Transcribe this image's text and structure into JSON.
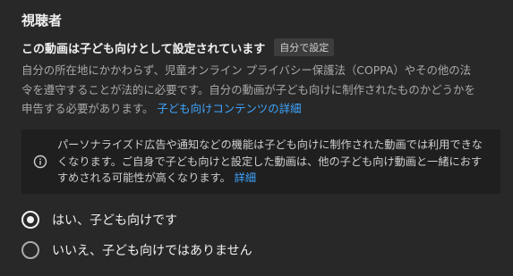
{
  "audience": {
    "title": "視聴者",
    "status_text": "この動画は子ども向けとして設定されています",
    "status_badge": "自分で設定",
    "description_lines": [
      "自分の所在地にかかわらず、児童オンライン プライバシー保護法（COPPA）やその他の法",
      "令を遵守することが法的に必要です。自分の動画が子ども向けに制作されたものかどうかを",
      "申告する必要があります。"
    ],
    "description_link": "子ども向けコンテンツの詳細",
    "info": {
      "icon": "info-icon",
      "lines": [
        "パーソナライズド広告や通知などの機能は子ども向けに制作された動画では利用できな",
        "くなります。ご自身で子ども向けと設定した動画は、他の子ども向け動画と一緒におす",
        "すめされる可能性が高くなります。"
      ],
      "link": "詳細"
    },
    "options": [
      {
        "label": "はい、子ども向けです",
        "selected": true
      },
      {
        "label": "いいえ、子ども向けではありません",
        "selected": false
      }
    ]
  },
  "colors": {
    "background": "#282828",
    "info_box": "#1f1f1f",
    "link": "#3ea6ff",
    "text_primary": "#f1f1f1",
    "text_secondary": "#aaaaaa"
  }
}
